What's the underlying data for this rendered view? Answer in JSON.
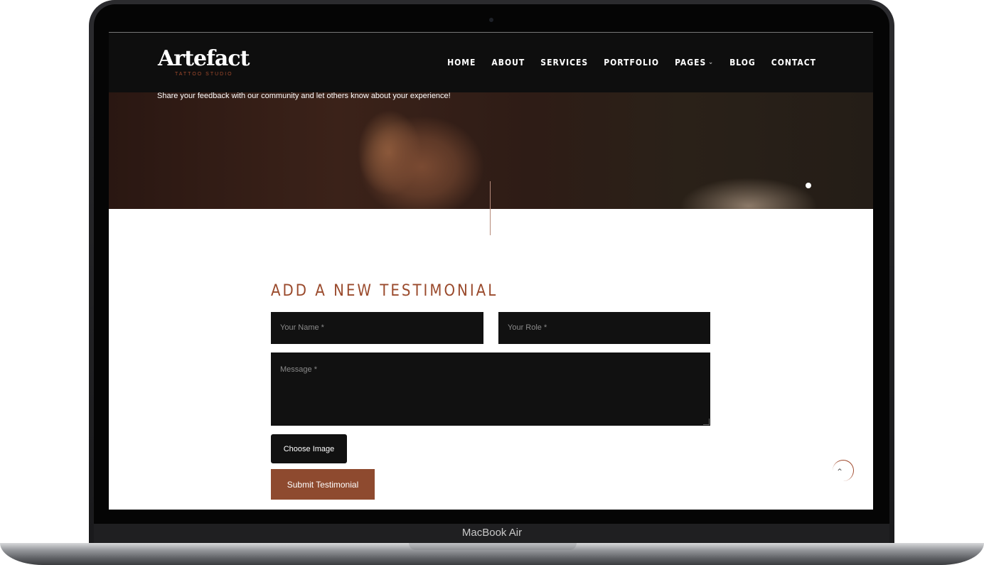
{
  "device": {
    "label": "MacBook Air"
  },
  "brand": {
    "logo_text": "Artefact",
    "logo_sub": "TATTOO STUDIO"
  },
  "nav": {
    "items": [
      {
        "label": "HOME"
      },
      {
        "label": "ABOUT"
      },
      {
        "label": "SERVICES"
      },
      {
        "label": "PORTFOLIO"
      },
      {
        "label": "PAGES",
        "icon": "chevron-down-icon"
      },
      {
        "label": "BLOG"
      },
      {
        "label": "CONTACT"
      }
    ]
  },
  "hero": {
    "text": "Share your feedback with our community and let others know about your experience!"
  },
  "form": {
    "title": "ADD A NEW TESTIMONIAL",
    "name_placeholder": "Your Name *",
    "role_placeholder": "Your Role *",
    "message_placeholder": "Message *",
    "choose_label": "Choose Image",
    "submit_label": "Submit Testimonial"
  },
  "colors": {
    "accent": "#8e4a2f",
    "dark": "#111111"
  }
}
